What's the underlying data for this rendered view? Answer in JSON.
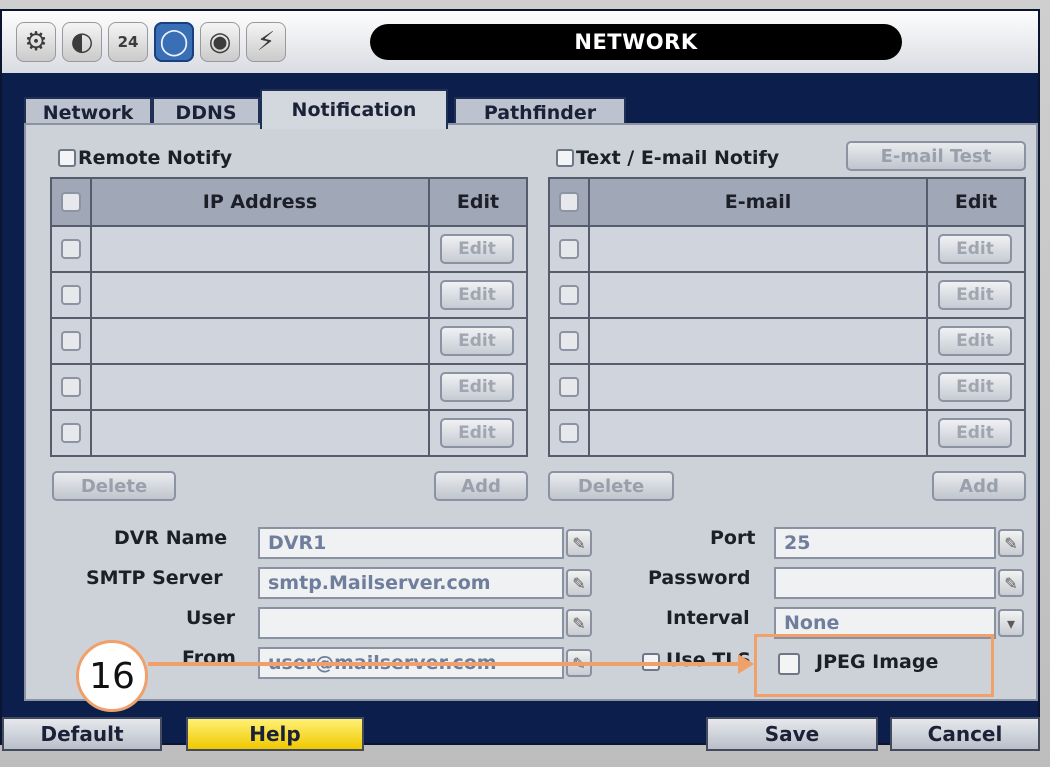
{
  "header": {
    "title": "NETWORK"
  },
  "toolbar_icons": [
    "gear-icon",
    "toggle-icon",
    "calendar-icon",
    "globe-icon",
    "disc-icon",
    "power-icon"
  ],
  "calendar_day": "24",
  "tabs": [
    {
      "label": "Network"
    },
    {
      "label": "DDNS"
    },
    {
      "label": "Notification"
    },
    {
      "label": "Pathfinder"
    }
  ],
  "remote": {
    "label": "Remote Notify",
    "col_address": "IP Address",
    "col_edit": "Edit",
    "edit_label": "Edit",
    "delete_label": "Delete",
    "add_label": "Add"
  },
  "email_notify": {
    "label": "Text / E-mail Notify",
    "test_label": "E-mail Test",
    "col_address": "E-mail",
    "col_edit": "Edit",
    "edit_label": "Edit",
    "delete_label": "Delete",
    "add_label": "Add"
  },
  "form": {
    "dvr_name_label": "DVR Name",
    "dvr_name_value": "DVR1",
    "smtp_label": "SMTP Server",
    "smtp_value": "smtp.Mailserver.com",
    "user_label": "User",
    "user_value": "",
    "from_label": "From",
    "from_value": "user@mailserver.com",
    "port_label": "Port",
    "port_value": "25",
    "password_label": "Password",
    "password_value": "",
    "interval_label": "Interval",
    "interval_value": "None",
    "tls_label": "Use TLS",
    "jpeg_label": "JPEG Image"
  },
  "footer": {
    "default_label": "Default",
    "help_label": "Help",
    "save_label": "Save",
    "cancel_label": "Cancel"
  },
  "annotation": {
    "number": "16"
  },
  "colors": {
    "accent_yellow": "#f5d000",
    "annotation": "#f0a06a",
    "window_bg": "#0c1f4c"
  }
}
